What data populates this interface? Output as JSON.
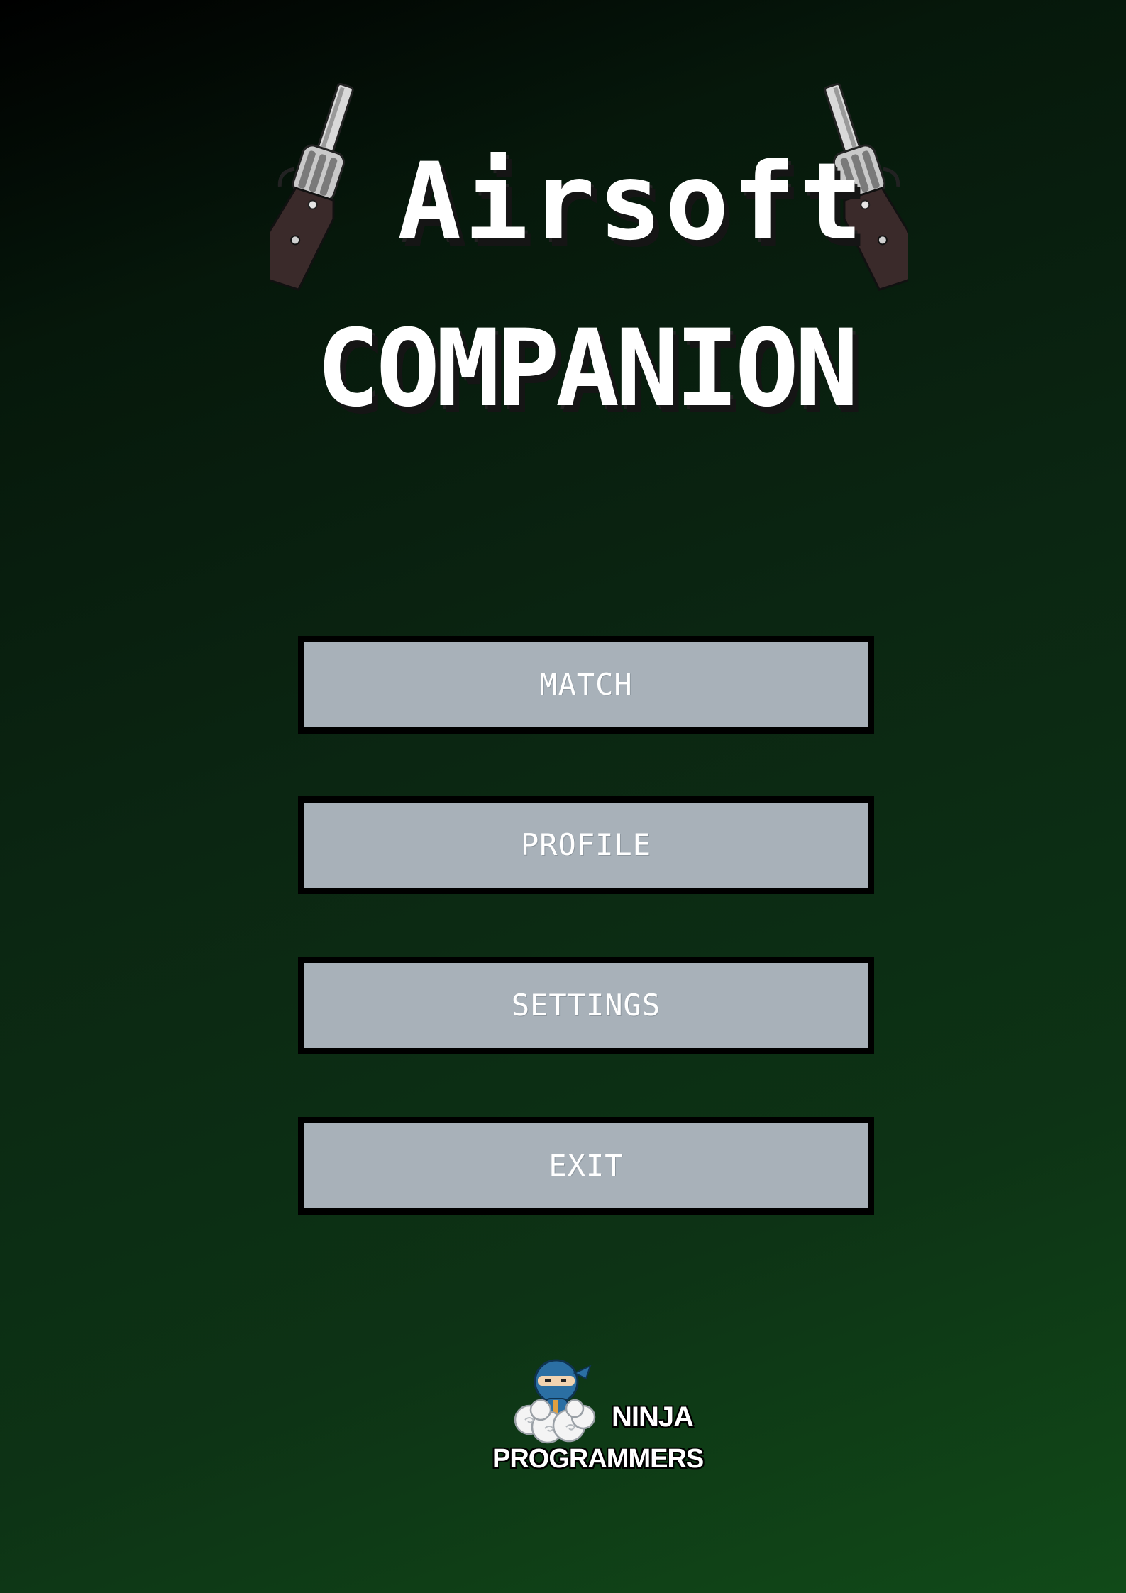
{
  "app": {
    "title_line_1": "Airsoft",
    "title_line_2": "COMPANION"
  },
  "menu": {
    "items": [
      {
        "label": "MATCH"
      },
      {
        "label": "PROFILE"
      },
      {
        "label": "SETTINGS"
      },
      {
        "label": "EXIT"
      }
    ]
  },
  "footer": {
    "brand_line_1": "NINJA",
    "brand_line_2": "PROGRAMMERS"
  },
  "icons": {
    "title_decoration": "revolver-icon",
    "brand_logo": "ninja-on-cloud-icon"
  },
  "colors": {
    "background_top": "#000000",
    "background_bottom": "#114a18",
    "button_fill": "#a8b1b9",
    "button_border": "#000000",
    "text": "#ffffff"
  }
}
